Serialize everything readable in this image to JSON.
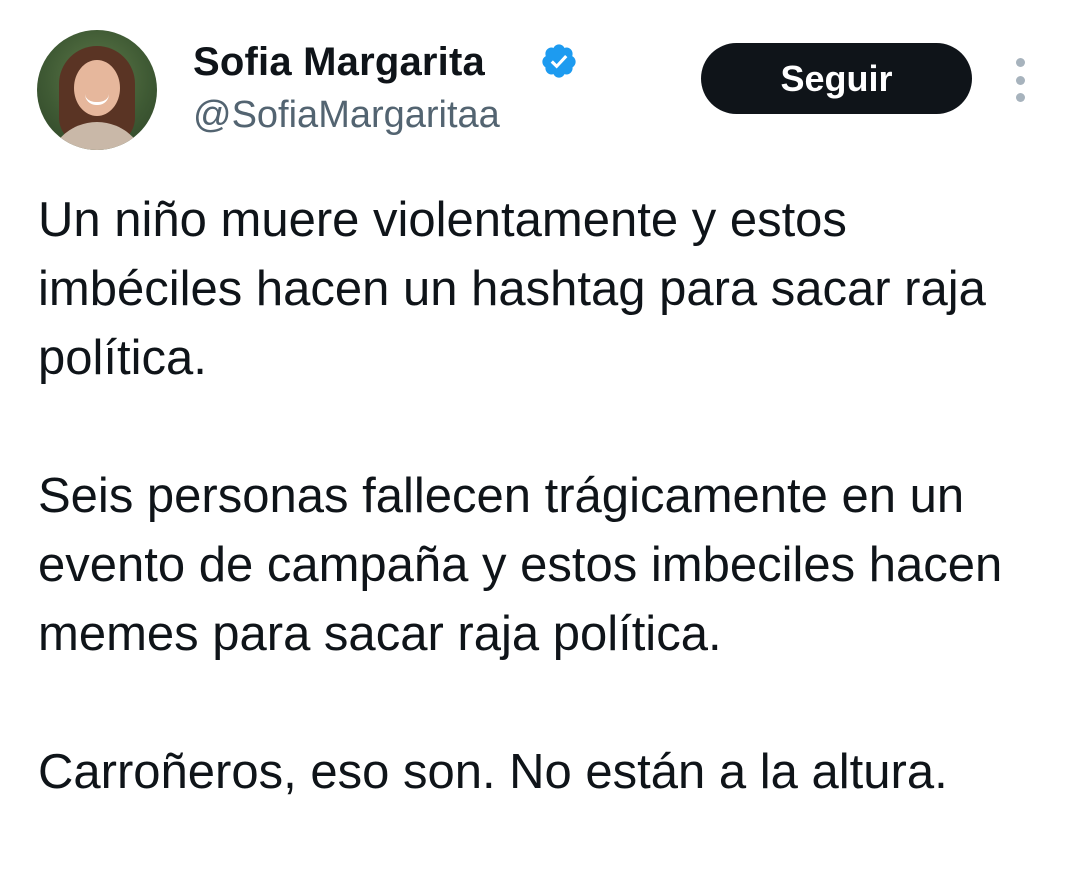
{
  "author": {
    "display_name": "Sofia Margarita",
    "handle": "@SofiaMargaritaa",
    "verified": true,
    "verified_color": "#1d9bf0"
  },
  "actions": {
    "follow_label": "Seguir",
    "more_icon": "more-vertical-icon"
  },
  "tweet": {
    "paragraphs": [
      "Un niño muere violentamente y estos imbéciles hacen un hashtag para sacar raja política.",
      "Seis personas fallecen trágicamente en un evento de campaña y estos imbeciles hacen memes para sacar raja política.",
      "Carroñeros, eso son. No están a la altura."
    ]
  }
}
